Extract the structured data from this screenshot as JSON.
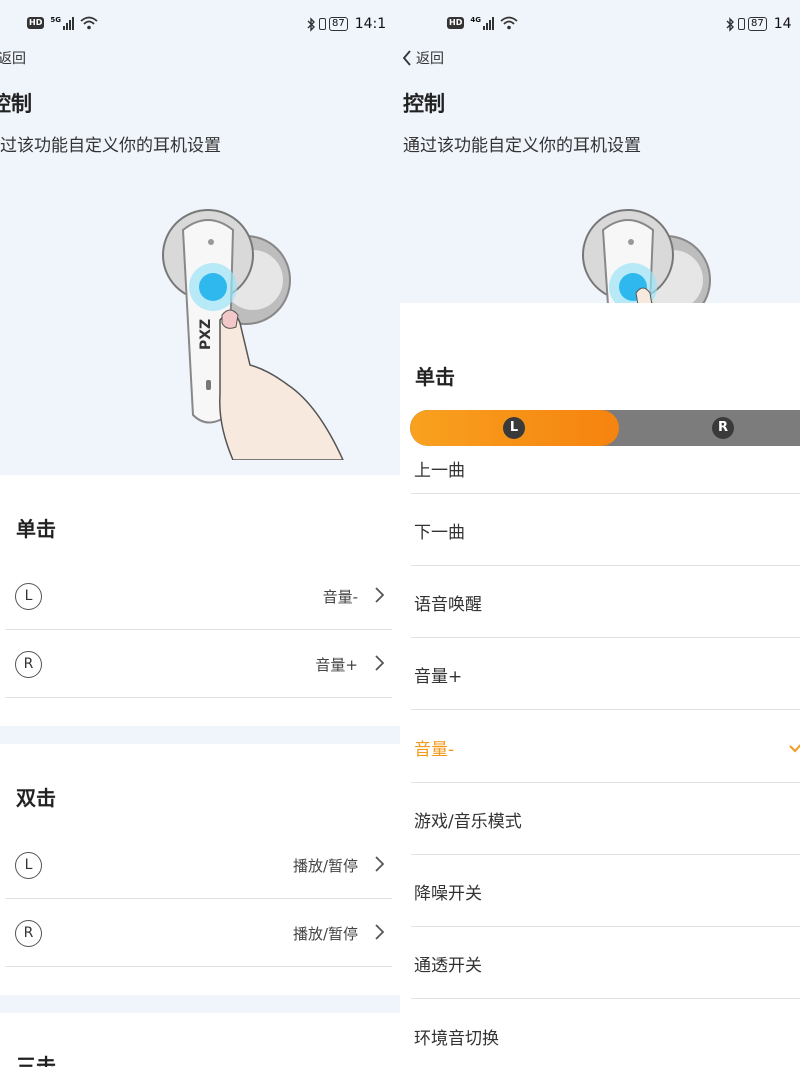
{
  "status_bar": {
    "hd": "HD",
    "network_left": "5G",
    "network_right": "4G",
    "battery": "87",
    "time_left": "14:1",
    "time_right": "14"
  },
  "header": {
    "back_label": "返回",
    "title": "控制",
    "subtitle": "通过该功能自定义你的耳机设置"
  },
  "sections": [
    {
      "title": "单击",
      "rows": [
        {
          "side": "L",
          "value": "音量-"
        },
        {
          "side": "R",
          "value": "音量+"
        }
      ]
    },
    {
      "title": "双击",
      "rows": [
        {
          "side": "L",
          "value": "播放/暂停"
        },
        {
          "side": "R",
          "value": "播放/暂停"
        }
      ]
    },
    {
      "title": "三击"
    }
  ],
  "popup": {
    "title": "单击",
    "segment": {
      "left": "L",
      "right": "R",
      "selected": "L"
    },
    "options": [
      "上一曲",
      "下一曲",
      "语音唤醒",
      "音量+",
      "音量-",
      "游戏/音乐模式",
      "降噪开关",
      "通透开关",
      "环境音切换"
    ],
    "selected_option": "音量-"
  },
  "colors": {
    "accent": "#f39a1c",
    "top_background": "#f0f4fb",
    "segment_inactive": "#7c7c7c"
  },
  "icons": {
    "back": "chevron-left-icon",
    "row_arrow": "chevron-right-icon",
    "selected": "checkmark-icon",
    "bluetooth": "bluetooth-icon",
    "wifi": "wifi-icon"
  }
}
